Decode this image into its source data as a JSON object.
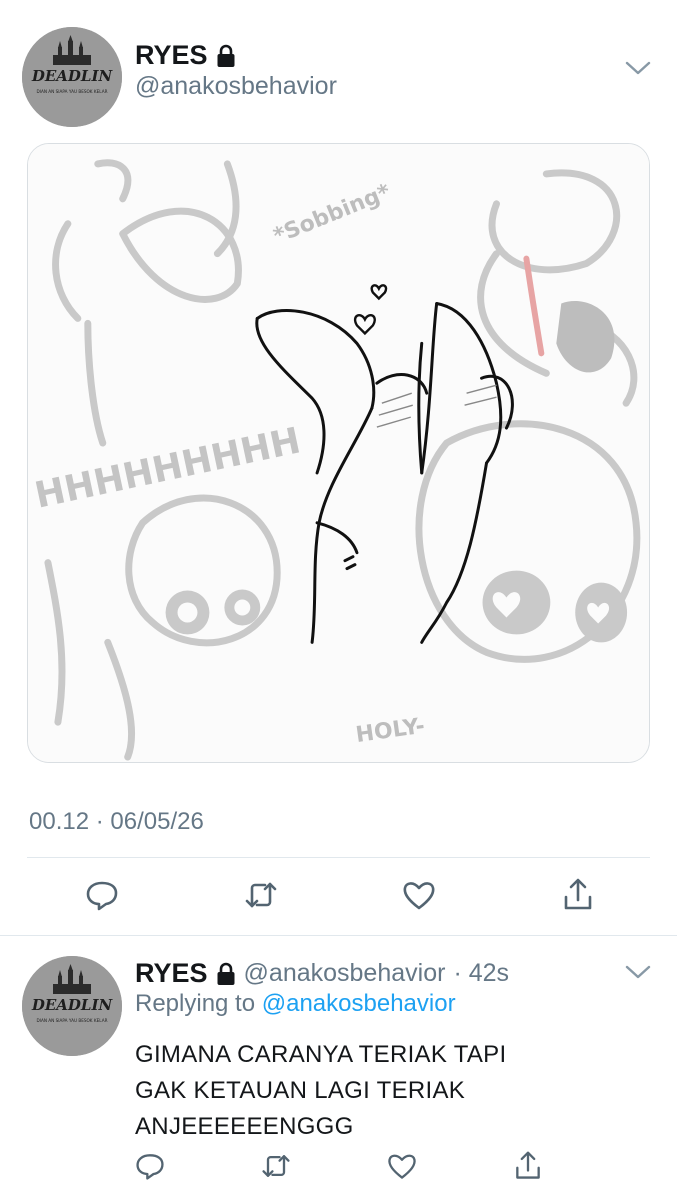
{
  "tweet": {
    "author": {
      "name": "RYES",
      "handle": "@anakosbehavior",
      "locked": true,
      "avatar_text": "DEADLIN",
      "avatar_subtext": "DIAN AN SIAPA YAU BESOK KELAR"
    },
    "media": {
      "doodle_texts": [
        "*Sobbing*",
        "HHHHHHHHH",
        "HOLY-"
      ]
    },
    "timestamp": "00.12 · 06/05/26",
    "actions": {
      "reply": "reply-icon",
      "retweet": "retweet-icon",
      "like": "heart-icon",
      "share": "share-icon"
    }
  },
  "reply": {
    "author": {
      "name": "RYES",
      "handle": "@anakosbehavior",
      "time": "· 42s",
      "locked": true
    },
    "replying_prefix": "Replying to",
    "replying_to": "@anakosbehavior",
    "text_lines": [
      "GIMANA CARANYA TERIAK TAPI",
      "GAK KETAUAN LAGI TERIAK",
      "ANJEEEEEENGGG"
    ]
  },
  "colors": {
    "text_primary": "#14171a",
    "text_secondary": "#657786",
    "link": "#1da1f2",
    "divider": "#e1e8ed"
  }
}
